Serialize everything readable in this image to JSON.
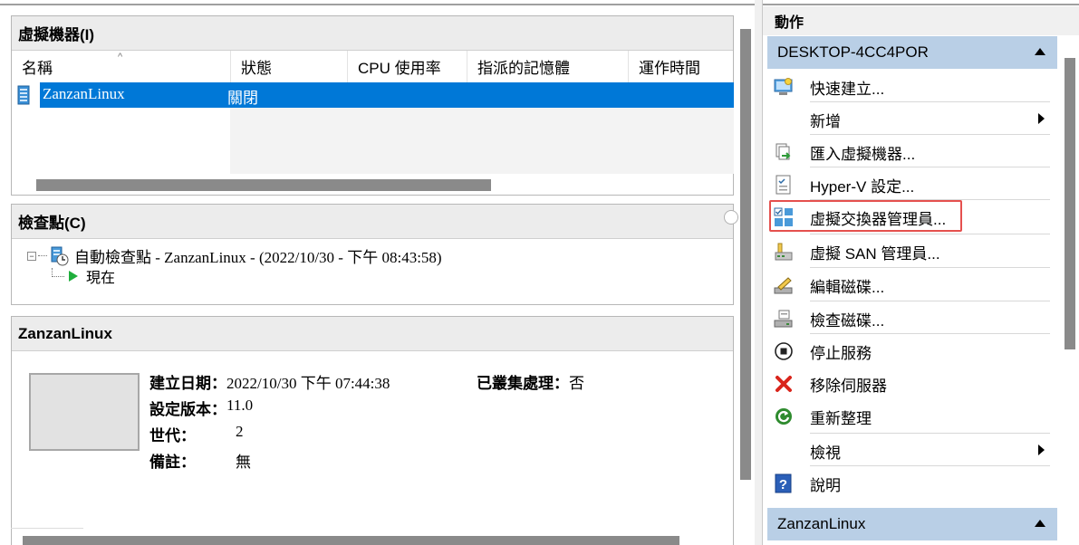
{
  "vm_panel": {
    "title": "虛擬機器(I)",
    "columns": [
      "名稱",
      "狀態",
      "CPU 使用率",
      "指派的記憶體",
      "運作時間"
    ],
    "rows": [
      {
        "name": "ZanzanLinux",
        "state": "關閉"
      }
    ]
  },
  "checkpoint_panel": {
    "title": "檢查點(C)",
    "items": [
      {
        "label": "自動檢查點 - ZanzanLinux - (2022/10/30 - 下午 08:43:58)"
      },
      {
        "label": "現在"
      }
    ]
  },
  "details_panel": {
    "title": "ZanzanLinux",
    "fields": [
      {
        "key": "建立日期：",
        "value": "2022/10/30 下午 07:44:38"
      },
      {
        "key": "設定版本：",
        "value": "11.0"
      },
      {
        "key": "世代：",
        "value": "2"
      },
      {
        "key": "備註：",
        "value": "無"
      }
    ],
    "clustered": {
      "key": "已叢集處理：",
      "value": "否"
    }
  },
  "actions_pane": {
    "title": "動作",
    "groups": [
      {
        "name": "DESKTOP-4CC4POR",
        "items": [
          {
            "label": "快速建立...",
            "icon": "quick-create-icon"
          },
          {
            "label": "新增",
            "icon": "none",
            "submenu": true
          },
          {
            "label": "匯入虛擬機器...",
            "icon": "import-icon"
          },
          {
            "label": "Hyper-V 設定...",
            "icon": "settings-document-icon"
          },
          {
            "label": "虛擬交換器管理員...",
            "icon": "virtual-switch-icon",
            "highlighted": true
          },
          {
            "label": "虛擬 SAN 管理員...",
            "icon": "san-icon"
          },
          {
            "label": "編輯磁碟...",
            "icon": "edit-disk-icon"
          },
          {
            "label": "檢查磁碟...",
            "icon": "inspect-disk-icon"
          },
          {
            "label": "停止服務",
            "icon": "stop-icon"
          },
          {
            "label": "移除伺服器",
            "icon": "remove-x-icon"
          },
          {
            "label": "重新整理",
            "icon": "refresh-icon"
          },
          {
            "label": "檢視",
            "icon": "none",
            "submenu": true
          },
          {
            "label": "說明",
            "icon": "help-icon"
          }
        ]
      },
      {
        "name": "ZanzanLinux",
        "items": []
      }
    ]
  },
  "colors": {
    "selection": "#0078d7",
    "group_header": "#b9cfe6",
    "highlight_border": "#e5504e",
    "remove_red": "#d9251c",
    "refresh_green": "#2e8b2e",
    "play_green": "#1fae3c"
  }
}
